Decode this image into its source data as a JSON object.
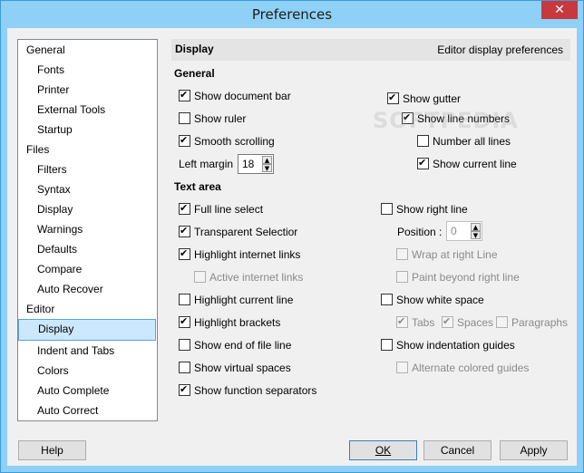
{
  "window": {
    "title": "Preferences",
    "close_glyph": "✕"
  },
  "nav": {
    "items": [
      {
        "label": "General",
        "level": 0
      },
      {
        "label": "Fonts",
        "level": 1
      },
      {
        "label": "Printer",
        "level": 1
      },
      {
        "label": "External Tools",
        "level": 1
      },
      {
        "label": "Startup",
        "level": 1
      },
      {
        "label": "Files",
        "level": 0
      },
      {
        "label": "Filters",
        "level": 1
      },
      {
        "label": "Syntax",
        "level": 1
      },
      {
        "label": "Display",
        "level": 1
      },
      {
        "label": "Warnings",
        "level": 1
      },
      {
        "label": "Defaults",
        "level": 1
      },
      {
        "label": "Compare",
        "level": 1
      },
      {
        "label": "Auto Recover",
        "level": 1
      },
      {
        "label": "Editor",
        "level": 0
      },
      {
        "label": "Display",
        "level": 1,
        "selected": true
      },
      {
        "label": "Indent and Tabs",
        "level": 1
      },
      {
        "label": "Colors",
        "level": 1
      },
      {
        "label": "Auto Complete",
        "level": 1
      },
      {
        "label": "Auto Correct",
        "level": 1
      }
    ]
  },
  "panel": {
    "title": "Display",
    "description": "Editor display preferences",
    "general": {
      "heading": "General",
      "show_document_bar": {
        "label": "Show document bar",
        "checked": true
      },
      "show_ruler": {
        "label": "Show ruler",
        "checked": false
      },
      "smooth_scrolling": {
        "label": "Smooth scrolling",
        "checked": true
      },
      "left_margin": {
        "label": "Left margin",
        "value": "18"
      },
      "show_gutter": {
        "label": "Show gutter",
        "checked": true
      },
      "show_line_numbers": {
        "label": "Show line numbers",
        "checked": true
      },
      "number_all_lines": {
        "label": "Number all lines",
        "checked": false
      },
      "show_current_line": {
        "label": "Show current line",
        "checked": true
      }
    },
    "text_area": {
      "heading": "Text area",
      "full_line_select": {
        "label": "Full line select",
        "checked": true
      },
      "transparent_selection": {
        "label": "Transparent Selectior",
        "checked": true
      },
      "highlight_internet_links": {
        "label": "Highlight internet links",
        "checked": true
      },
      "active_internet_links": {
        "label": "Active internet links",
        "checked": false,
        "disabled": true
      },
      "highlight_current_line": {
        "label": "Highlight current line",
        "checked": false
      },
      "highlight_brackets": {
        "label": "Highlight brackets",
        "checked": true
      },
      "show_end_of_file_line": {
        "label": "Show end of file line",
        "checked": false
      },
      "show_virtual_spaces": {
        "label": "Show virtual spaces",
        "checked": false
      },
      "show_function_separators": {
        "label": "Show function separators",
        "checked": true
      },
      "show_right_line": {
        "label": "Show right line",
        "checked": false
      },
      "position": {
        "label": "Position :",
        "value": "0",
        "disabled": true
      },
      "wrap_at_right_line": {
        "label": "Wrap at right Line",
        "checked": false,
        "disabled": true
      },
      "paint_beyond_right_line": {
        "label": "Paint beyond right line",
        "checked": false,
        "disabled": true
      },
      "show_white_space": {
        "label": "Show white space",
        "checked": false
      },
      "tabs": {
        "label": "Tabs",
        "checked": true,
        "disabled": true
      },
      "spaces": {
        "label": "Spaces",
        "checked": true,
        "disabled": true
      },
      "paragraphs": {
        "label": "Paragraphs",
        "checked": false,
        "disabled": true
      },
      "show_indentation_guides": {
        "label": "Show indentation guides",
        "checked": false
      },
      "alternate_colored_guides": {
        "label": "Alternate colored guides",
        "checked": false,
        "disabled": true
      }
    }
  },
  "buttons": {
    "help": "Help",
    "ok": "OK",
    "cancel": "Cancel",
    "apply": "Apply"
  },
  "watermark": "SOFTPEDIA"
}
